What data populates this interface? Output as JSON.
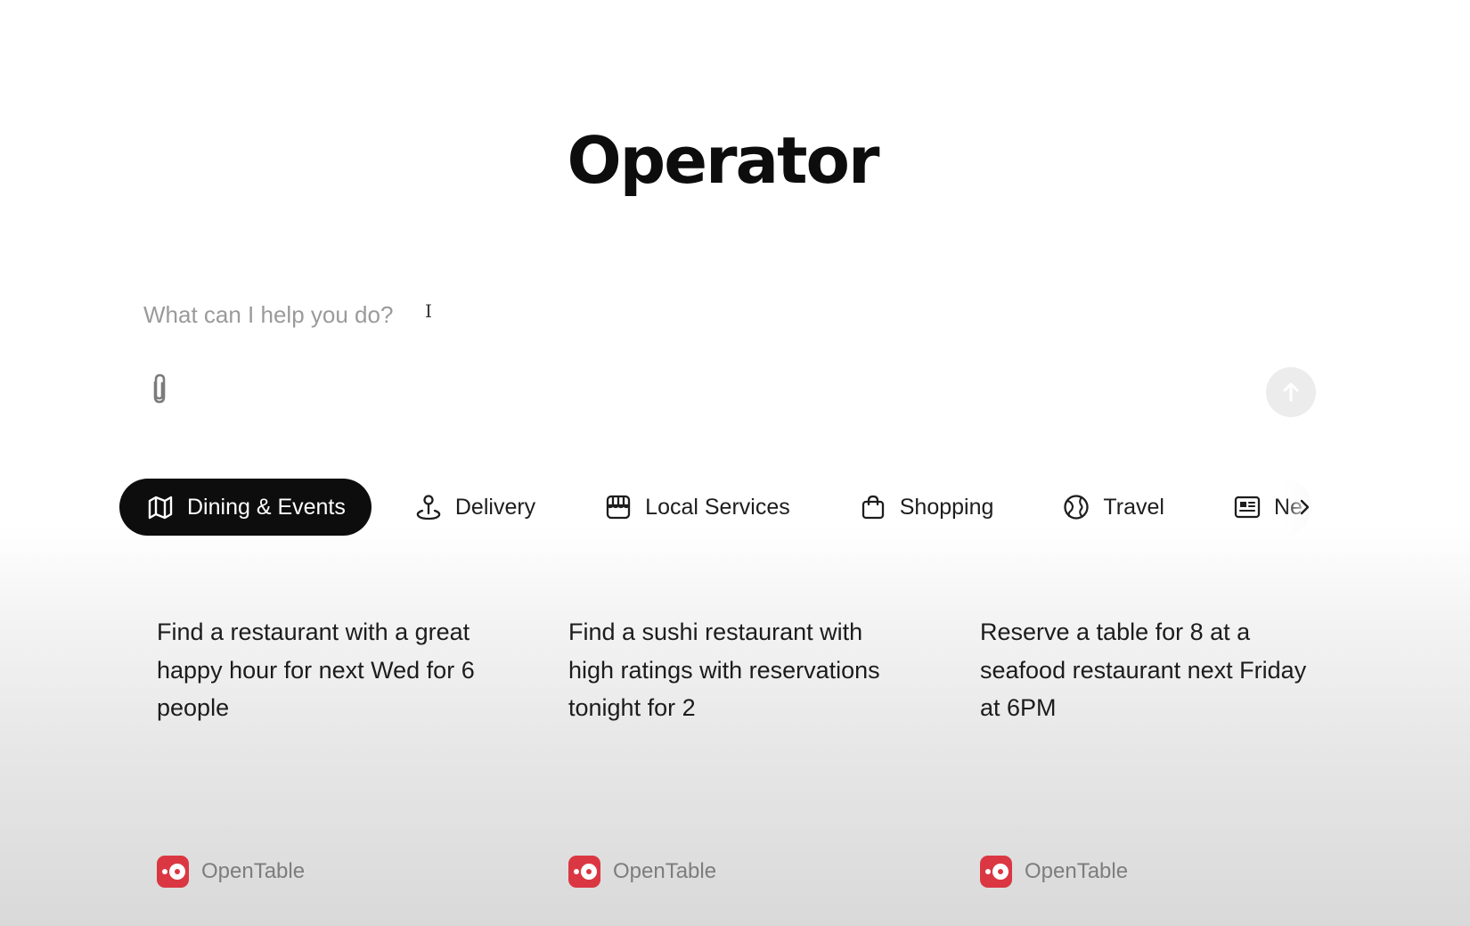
{
  "header": {
    "title": "Operator"
  },
  "composer": {
    "placeholder": "What can I help you do?",
    "value": "",
    "attach_icon": "paperclip-icon",
    "send_icon": "arrow-up-icon"
  },
  "tabs": [
    {
      "label": "Dining & Events",
      "icon": "map-icon",
      "active": true
    },
    {
      "label": "Delivery",
      "icon": "location-pin-icon",
      "active": false
    },
    {
      "label": "Local Services",
      "icon": "storefront-icon",
      "active": false
    },
    {
      "label": "Shopping",
      "icon": "shopping-bag-icon",
      "active": false
    },
    {
      "label": "Travel",
      "icon": "globe-icon",
      "active": false
    },
    {
      "label": "Ne",
      "icon": "newspaper-icon",
      "active": false
    }
  ],
  "tabs_next_icon": "chevron-right-icon",
  "cards": [
    {
      "text": "Find a restaurant with a great happy hour for next Wed for 6 people",
      "source": "OpenTable"
    },
    {
      "text": "Find a sushi restaurant with high ratings with reservations tonight for 2",
      "source": "OpenTable"
    },
    {
      "text": "Reserve a table for 8 at a seafood restaurant next Friday at 6PM",
      "source": "OpenTable"
    }
  ],
  "colors": {
    "active_tab_bg": "#0d0d0d",
    "opentable_brand": "#da3743",
    "send_button_bg": "#ececec"
  }
}
